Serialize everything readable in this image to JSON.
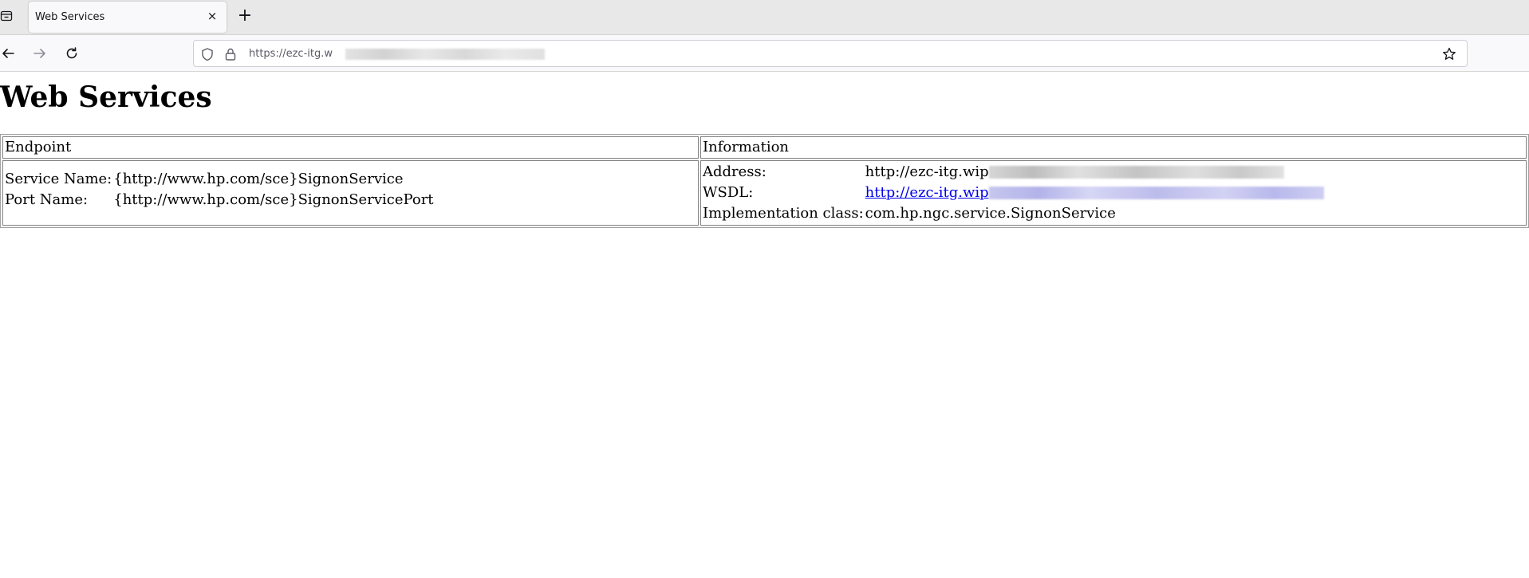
{
  "browser": {
    "tab": {
      "title": "Web Services",
      "close_glyph": "×"
    },
    "new_tab_glyph": "+",
    "url": "https://ezc-itg.w"
  },
  "page": {
    "title": "Web Services",
    "table": {
      "headers": {
        "endpoint": "Endpoint",
        "information": "Information"
      },
      "endpoint": {
        "service_name_label": "Service Name:",
        "service_name_value": "{http://www.hp.com/sce}SignonService",
        "port_name_label": "Port Name:",
        "port_name_value": "{http://www.hp.com/sce}SignonServicePort"
      },
      "information": {
        "address_label": "Address:",
        "address_value": "http://ezc-itg.wip",
        "wsdl_label": "WSDL:",
        "wsdl_value": "http://ezc-itg.wip",
        "impl_label": "Implementation class:",
        "impl_value": "com.hp.ngc.service.SignonService"
      }
    }
  },
  "colors": {
    "link": "#0000ee",
    "chrome_bg": "#e8e8e8",
    "toolbar_bg": "#f9f9fb"
  },
  "icons": [
    "tab-list-icon",
    "close-icon",
    "plus-icon",
    "back-arrow-icon",
    "forward-arrow-icon",
    "reload-icon",
    "shield-icon",
    "lock-icon",
    "star-icon"
  ]
}
